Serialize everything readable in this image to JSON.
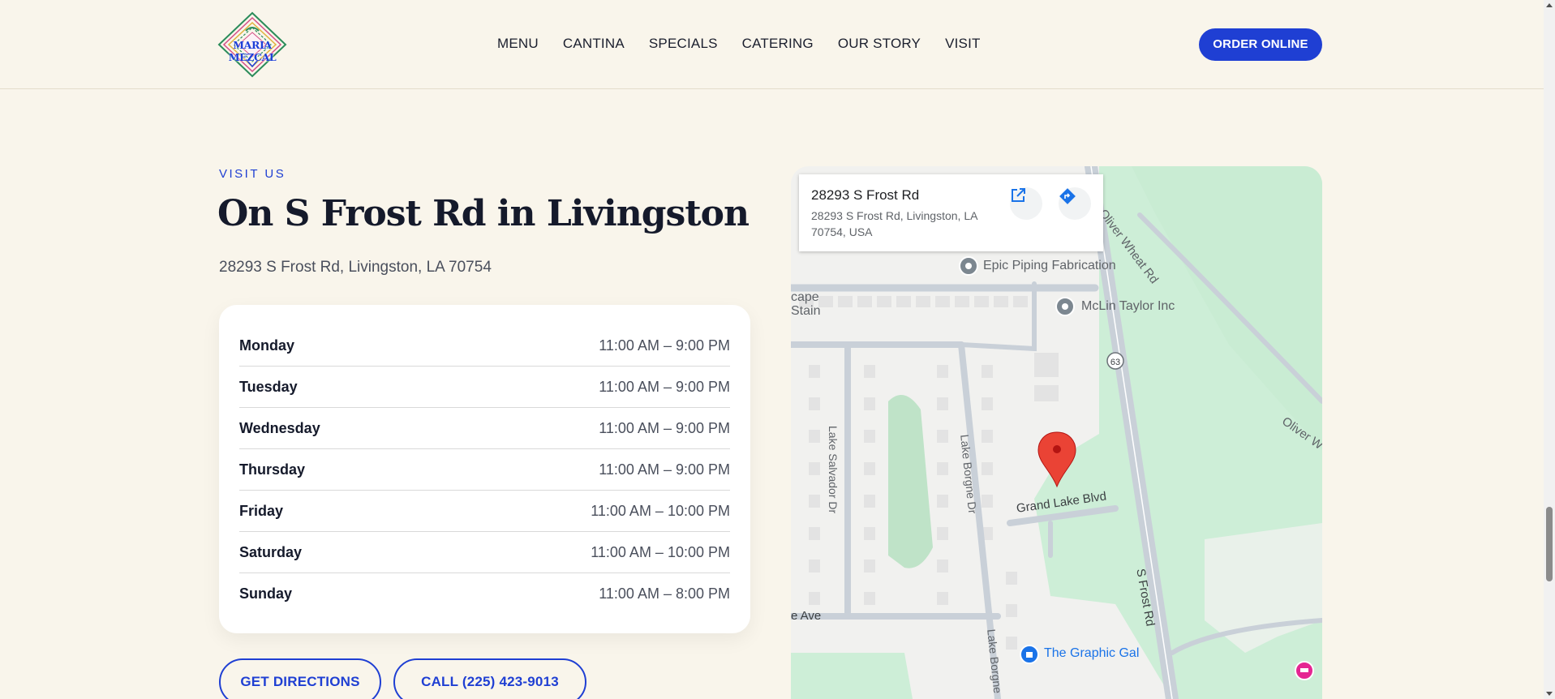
{
  "header": {
    "logo_text": "MARIA MEZCAL",
    "nav": [
      "MENU",
      "CANTINA",
      "SPECIALS",
      "CATERING",
      "OUR STORY",
      "VISIT"
    ],
    "order_label": "ORDER ONLINE"
  },
  "visit": {
    "kicker": "VISIT US",
    "title": "On S Frost Rd in Livingston",
    "address": "28293 S Frost Rd, Livingston, LA 70754",
    "hours": [
      {
        "day": "Monday",
        "time": "11:00 AM – 9:00 PM"
      },
      {
        "day": "Tuesday",
        "time": "11:00 AM – 9:00 PM"
      },
      {
        "day": "Wednesday",
        "time": "11:00 AM – 9:00 PM"
      },
      {
        "day": "Thursday",
        "time": "11:00 AM – 9:00 PM"
      },
      {
        "day": "Friday",
        "time": "11:00 AM – 10:00 PM"
      },
      {
        "day": "Saturday",
        "time": "11:00 AM – 10:00 PM"
      },
      {
        "day": "Sunday",
        "time": "11:00 AM – 8:00 PM"
      }
    ],
    "directions_label": "GET DIRECTIONS",
    "call_label": "CALL (225) 423-9013"
  },
  "map": {
    "card_title": "28293 S Frost Rd",
    "card_address": "28293 S Frost Rd, Livingston, LA 70754, USA",
    "open_icon": "open-in-new-icon",
    "directions_icon": "directions-icon",
    "places": {
      "epic": "Epic Piping Fabrication",
      "mclin": "McLin Taylor Inc",
      "graphic": "The Graphic Gal",
      "cape": "cape",
      "stain": "Stain"
    },
    "roads": {
      "oliver_wheat": "Oliver Wheat Rd",
      "oliver": "Oliver W",
      "lake_salvador": "Lake Salvador Dr",
      "lake_borgne": "Lake Borgne Dr",
      "lake_borgne_2": "Lake Borgne",
      "grand_lake": "Grand Lake Blvd",
      "s_frost": "S Frost Rd",
      "e_ave": "e Ave",
      "route": "63"
    }
  },
  "colors": {
    "accent": "#1f3fd3",
    "background": "#f9f5eb",
    "map_green": "#cdeed7",
    "pin_red": "#ea4335"
  }
}
